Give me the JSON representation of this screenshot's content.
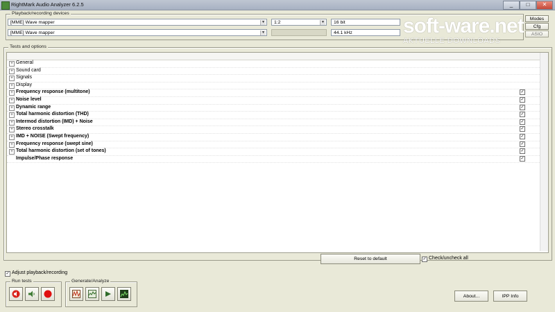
{
  "window": {
    "title": "RightMark Audio Analyzer 6.2.5",
    "controls": [
      "_",
      "□",
      "✕"
    ]
  },
  "playback_group": {
    "label": "Playback/recording devices",
    "playback_device": "[MME] Wave mapper",
    "recording_device": "[MME] Wave mapper",
    "channels": "1:2",
    "bit_depth": "16 bit",
    "sample_rate": "44.1 kHz",
    "modes_button": "Modes",
    "cfg_button": "Cfg",
    "asio_button": "ASIO"
  },
  "tests_group": {
    "label": "Tests and options",
    "items": [
      {
        "label": "General",
        "expander": "+",
        "bold": false,
        "checked": null
      },
      {
        "label": "Sound card",
        "expander": "+",
        "bold": false,
        "checked": null
      },
      {
        "label": "Signals",
        "expander": "+",
        "bold": false,
        "checked": null
      },
      {
        "label": "Display",
        "expander": "+",
        "bold": false,
        "checked": null
      },
      {
        "label": "Frequency response (multitone)",
        "expander": "+",
        "bold": true,
        "checked": true
      },
      {
        "label": "Noise level",
        "expander": "+",
        "bold": true,
        "checked": true
      },
      {
        "label": "Dynamic range",
        "expander": "+",
        "bold": true,
        "checked": true
      },
      {
        "label": "Total harmonic distortion (THD)",
        "expander": "+",
        "bold": true,
        "checked": true
      },
      {
        "label": "Intermod distortion (IMD) + Noise",
        "expander": "+",
        "bold": true,
        "checked": true
      },
      {
        "label": "Stereo crosstalk",
        "expander": "+",
        "bold": true,
        "checked": true
      },
      {
        "label": "IMD + NOISE (Swept frequency)",
        "expander": "+",
        "bold": true,
        "checked": true
      },
      {
        "label": "Frequency response (swept sine)",
        "expander": "+",
        "bold": true,
        "checked": true
      },
      {
        "label": "Total harmonic distortion (set of tones)",
        "expander": "+",
        "bold": true,
        "checked": true
      },
      {
        "label": "Impulse/Phase response",
        "expander": "",
        "bold": true,
        "checked": true
      }
    ]
  },
  "reset_button": "Reset to default",
  "check_all_label": "Check/uncheck all",
  "adjust_label": "Adjust playback/recording",
  "run_tests": {
    "label": "Run tests",
    "icons": [
      "stop-speaker-icon",
      "speaker-icon",
      "record-icon"
    ]
  },
  "generate": {
    "label": "Generate/Analyze",
    "icons": [
      "generate-signal-icon",
      "analyze-icon",
      "play-icon",
      "spectrum-icon"
    ]
  },
  "about_button": "About...",
  "ipp_button": "IPP Info",
  "watermark": {
    "logo": "soft-ware.net",
    "tagline": "AKTUELLE DOWNLOADS"
  },
  "colors": {
    "background": "#e9e9d8",
    "record": "#e01010",
    "titlebar": "#a7b1c2"
  }
}
